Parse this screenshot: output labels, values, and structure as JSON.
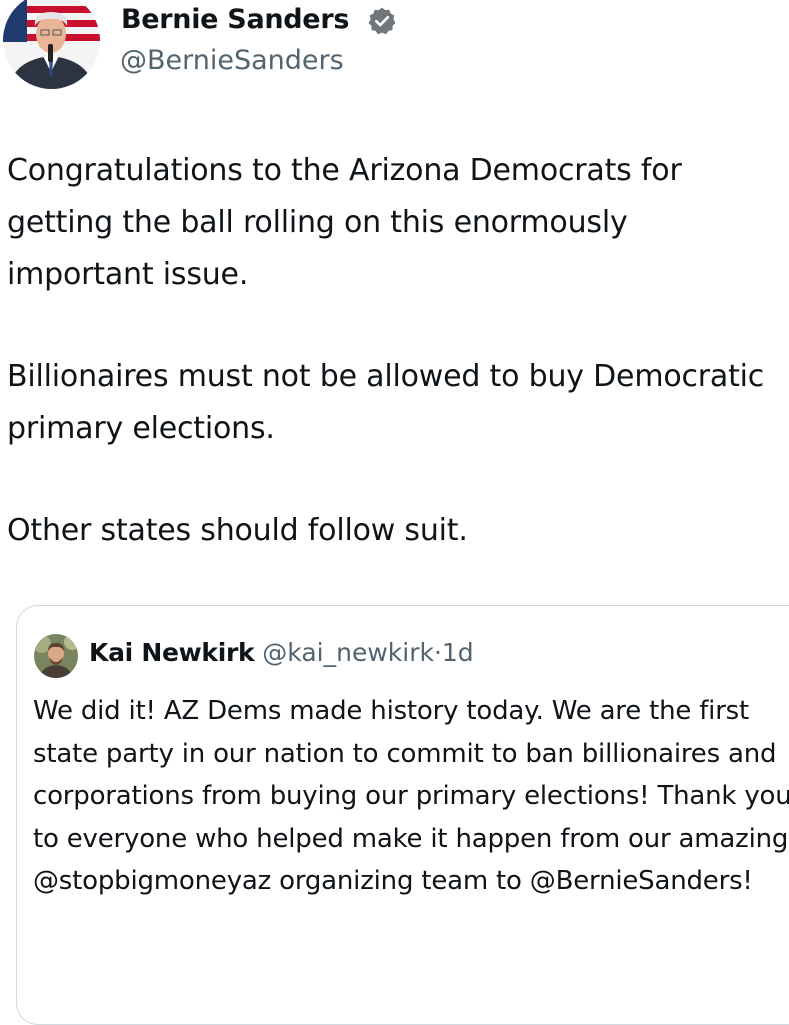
{
  "author": {
    "name": "Bernie Sanders",
    "handle": "@BernieSanders",
    "verified_icon": "verified-badge-icon",
    "verified_color": "#71767b"
  },
  "tweet": {
    "paragraphs": [
      "Congratulations to the Arizona Democrats for getting the ball rolling on this enormously important issue.",
      "Billionaires must not be allowed to buy Democratic primary elections.",
      "Other states should follow suit."
    ]
  },
  "quote": {
    "name": "Kai Newkirk",
    "handle": "@kai_newkirk",
    "separator": "·",
    "time": "1d",
    "text": "We did it! AZ Dems made history today. We are the first state party in our nation to commit to ban billionaires and corporations from buying our primary elections! Thank you to everyone who helped make it happen from our amazing @stopbigmoneyaz organizing team to @BernieSanders!"
  },
  "colors": {
    "text": "#0f1419",
    "secondary_text": "#536471",
    "card_border": "#cfd9de",
    "flag_red": "#c8102e",
    "flag_blue": "#1f3a6e"
  }
}
